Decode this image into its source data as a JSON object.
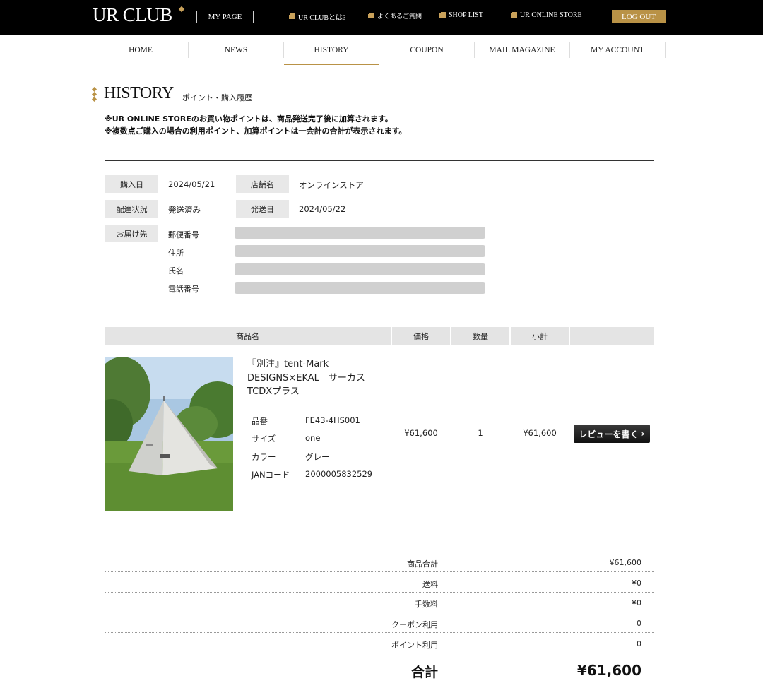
{
  "header": {
    "logo": "UR CLUB",
    "mypage": "MY PAGE",
    "links": [
      "UR CLUBとは?",
      "よくあるご質問",
      "SHOP LIST",
      "UR ONLINE STORE"
    ],
    "logout": "LOG OUT"
  },
  "nav": [
    "HOME",
    "NEWS",
    "HISTORY",
    "COUPON",
    "MAIL MAGAZINE",
    "MY ACCOUNT"
  ],
  "nav_active": "HISTORY",
  "heading": {
    "title": "HISTORY",
    "subtitle": "ポイント・購入履歴"
  },
  "notes": [
    "※UR ONLINE STOREのお買い物ポイントは、商品発送完了後に加算されます。",
    "※複数点ご購入の場合の利用ポイント、加算ポイントは一会計の合計が表示されます。"
  ],
  "order": {
    "purchase_date_label": "購入日",
    "purchase_date": "2024/05/21",
    "store_label": "店舗名",
    "store": "オンラインストア",
    "delivery_status_label": "配達状況",
    "delivery_status": "発送済み",
    "ship_date_label": "発送日",
    "ship_date": "2024/05/22",
    "destination_label": "お届け先",
    "destination_fields": [
      "郵便番号",
      "住所",
      "氏名",
      "電話番号"
    ]
  },
  "table": {
    "headers": [
      "商品名",
      "価格",
      "数量",
      "小計"
    ]
  },
  "item": {
    "name_lines": [
      "『別注』tent-Mark",
      "DESIGNS×EKAL　サーカス",
      "TCDXプラス"
    ],
    "attrs": [
      {
        "k": "品番",
        "v": "FE43-4HS001"
      },
      {
        "k": "サイズ",
        "v": "one"
      },
      {
        "k": "カラー",
        "v": "グレー"
      },
      {
        "k": "JANコード",
        "v": "2000005832529"
      }
    ],
    "price": "¥61,600",
    "qty": "1",
    "subtotal": "¥61,600",
    "review_button": "レビューを書く"
  },
  "totals": [
    {
      "label": "商品合計",
      "value": "¥61,600"
    },
    {
      "label": "送料",
      "value": "¥0"
    },
    {
      "label": "手数料",
      "value": "¥0"
    },
    {
      "label": "クーポン利用",
      "value": "0"
    },
    {
      "label": "ポイント利用",
      "value": "0"
    }
  ],
  "grand_total": {
    "label": "合計",
    "value": "¥61,600"
  },
  "colors": {
    "accent": "#b99246",
    "topbar": "#000000",
    "label_bg": "#e8e8e8"
  }
}
